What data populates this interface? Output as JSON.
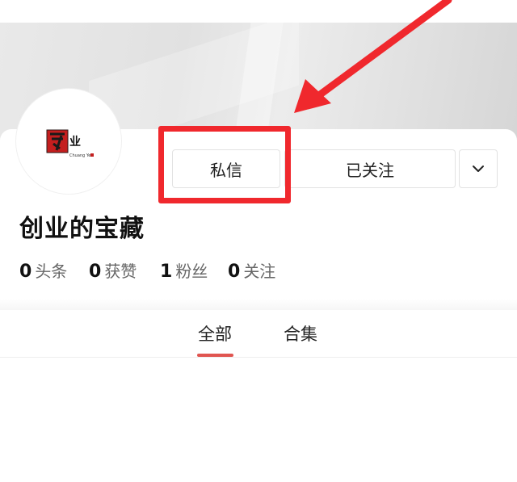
{
  "profile": {
    "name": "创业的宝藏",
    "avatar_text_main": "业",
    "avatar_text_sub": "Chuang Ye"
  },
  "buttons": {
    "message_label": "私信",
    "follow_label": "已关注",
    "more_icon": "chevron-down-icon"
  },
  "stats": [
    {
      "value": "0",
      "label": "头条"
    },
    {
      "value": "0",
      "label": "获赞"
    },
    {
      "value": "1",
      "label": "粉丝"
    },
    {
      "value": "0",
      "label": "关注"
    }
  ],
  "tabs": [
    {
      "label": "全部",
      "active": true
    },
    {
      "label": "合集",
      "active": false
    }
  ],
  "colors": {
    "annotation_red": "#f0282d",
    "tab_accent": "#e05550"
  }
}
